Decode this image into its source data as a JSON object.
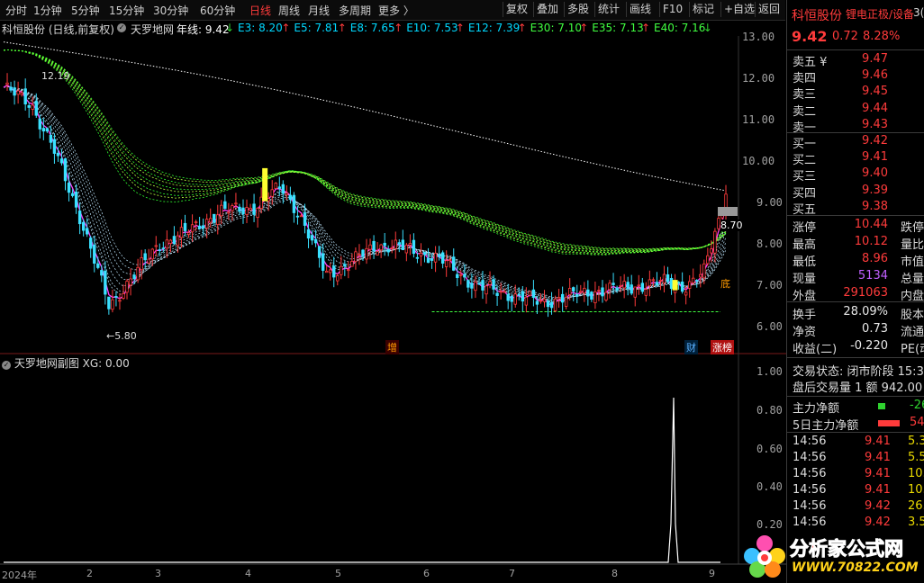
{
  "toolbar": {
    "periods": [
      "分时",
      "1分钟",
      "5分钟",
      "15分钟",
      "30分钟",
      "60分钟",
      "日线",
      "周线",
      "月线",
      "多周期",
      "更多 〉"
    ],
    "active_period": "日线",
    "buttons": [
      "复权",
      "叠加",
      "多股",
      "统计",
      "画线",
      "F10",
      "标记",
      "+自选",
      "返回"
    ]
  },
  "chart_header": {
    "stock": "科恒股份 (日线,前复权)",
    "indicator": "天罗地网",
    "items": [
      {
        "label": "年线: 9.42",
        "color": "#ffffff",
        "arrow": "↓"
      },
      {
        "label": "E3: 8.20",
        "color": "#00d8ff",
        "arrow": "↑"
      },
      {
        "label": "E5: 7.81",
        "color": "#00d8ff",
        "arrow": "↑"
      },
      {
        "label": "E8: 7.65",
        "color": "#00d8ff",
        "arrow": "↑"
      },
      {
        "label": "E10: 7.53",
        "color": "#00d8ff",
        "arrow": "↑"
      },
      {
        "label": "E12: 7.39",
        "color": "#00d8ff",
        "arrow": "↑"
      },
      {
        "label": "E30: 7.10",
        "color": "#40ff40",
        "arrow": "↑"
      },
      {
        "label": "E35: 7.13",
        "color": "#40ff40",
        "arrow": "↑"
      },
      {
        "label": "E40: 7.16",
        "color": "#40ff40",
        "arrow": "↓"
      }
    ]
  },
  "price_axis": [
    "13.00",
    "12.00",
    "11.00",
    "10.00",
    "9.00",
    "8.00",
    "7.00",
    "6.00"
  ],
  "annotations": {
    "high_label": "12.19",
    "low_label": "←5.80",
    "last_label": "8.70",
    "tags": [
      "增",
      "财",
      "涨榜"
    ],
    "bottom_tag": "底"
  },
  "sub_chart": {
    "header": "天罗地网副图  XG: 0.00",
    "axis": [
      "1.00",
      "0.80",
      "0.60",
      "0.40",
      "0.20"
    ]
  },
  "date_axis": [
    "2024年",
    "2",
    "3",
    "4",
    "5",
    "6",
    "7",
    "8",
    "9"
  ],
  "quote": {
    "name": "科恒股份",
    "sector": "锂电正极/设备",
    "sector_suffix": "3(",
    "price": "9.42",
    "change": "0.72",
    "change_pct": "8.28%",
    "asks": [
      {
        "label": "卖五 ¥",
        "price": "9.47"
      },
      {
        "label": "卖四",
        "price": "9.46"
      },
      {
        "label": "卖三",
        "price": "9.45"
      },
      {
        "label": "卖二",
        "price": "9.44"
      },
      {
        "label": "卖一",
        "price": "9.43"
      }
    ],
    "bids": [
      {
        "label": "买一",
        "price": "9.42"
      },
      {
        "label": "买二",
        "price": "9.41"
      },
      {
        "label": "买三",
        "price": "9.40"
      },
      {
        "label": "买四",
        "price": "9.39"
      },
      {
        "label": "买五",
        "price": "9.38"
      }
    ],
    "stats": [
      {
        "k": "涨停",
        "v": "10.44",
        "c": "red",
        "k2": "跌停"
      },
      {
        "k": "最高",
        "v": "10.12",
        "c": "red",
        "k2": "量比"
      },
      {
        "k": "最低",
        "v": "8.96",
        "c": "red",
        "k2": "市值"
      },
      {
        "k": "现量",
        "v": "5134",
        "c": "mag",
        "k2": "总量"
      },
      {
        "k": "外盘",
        "v": "291063",
        "c": "red",
        "k2": "内盘"
      }
    ],
    "stats2": [
      {
        "k": "换手",
        "v": "28.09%",
        "c": "white",
        "k2": "股本"
      },
      {
        "k": "净资",
        "v": "0.73",
        "c": "white",
        "k2": "流通"
      },
      {
        "k": "收益(二)",
        "v": "-0.220",
        "c": "white",
        "k2": "PE(动"
      }
    ],
    "status1": "交易状态: 闭市阶段 15:3",
    "status2": "盘后交易量 1 额 942.00",
    "flow": [
      {
        "k": "主力净额",
        "v": "-26",
        "c": "green"
      },
      {
        "k": "5日主力净额",
        "v": "54",
        "c": "red"
      }
    ],
    "ticks": [
      {
        "t": "14:56",
        "p": "9.41",
        "v": "5.3",
        "pc": "red",
        "vc": "yellow"
      },
      {
        "t": "14:56",
        "p": "9.41",
        "v": "5.5",
        "pc": "red",
        "vc": "yellow"
      },
      {
        "t": "14:56",
        "p": "9.41",
        "v": "10.2",
        "pc": "red",
        "vc": "yellow"
      },
      {
        "t": "14:56",
        "p": "9.41",
        "v": "10.5",
        "pc": "red",
        "vc": "yellow"
      },
      {
        "t": "14:56",
        "p": "9.42",
        "v": "26.7",
        "pc": "red",
        "vc": "yellow"
      },
      {
        "t": "14:56",
        "p": "9.42",
        "v": "3.5",
        "pc": "red",
        "vc": "yellow"
      }
    ]
  },
  "watermark": {
    "title": "分析家公式网",
    "url": "WWW.70822.COM"
  }
}
